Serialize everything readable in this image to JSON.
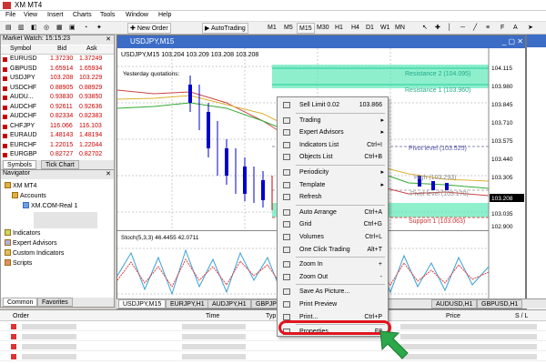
{
  "app": {
    "title": "XM MT4"
  },
  "menu": [
    "File",
    "View",
    "Insert",
    "Charts",
    "Tools",
    "Window",
    "Help"
  ],
  "toolbar": {
    "new_order": "New Order",
    "auto_trading": "AutoTrading",
    "timeframes": [
      "M1",
      "M5",
      "M15",
      "M30",
      "H1",
      "H4",
      "D1",
      "W1",
      "MN"
    ]
  },
  "market_watch": {
    "title": "Market Watch: 15:15:23",
    "cols": {
      "symbol": "Symbol",
      "bid": "Bid",
      "ask": "Ask"
    },
    "rows": [
      {
        "symbol": "EURUSD",
        "bid": "1.37230",
        "ask": "1.37249"
      },
      {
        "symbol": "GBPUSD",
        "bid": "1.65914",
        "ask": "1.65934"
      },
      {
        "symbol": "USDJPY",
        "bid": "103.208",
        "ask": "103.229"
      },
      {
        "symbol": "USDCHF",
        "bid": "0.88905",
        "ask": "0.88929"
      },
      {
        "symbol": "AUDU...",
        "bid": "0.93830",
        "ask": "0.93850"
      },
      {
        "symbol": "AUDCHF",
        "bid": "0.92611",
        "ask": "0.92636"
      },
      {
        "symbol": "AUDCHF",
        "bid": "0.82334",
        "ask": "0.82383"
      },
      {
        "symbol": "CHFJPY",
        "bid": "116.066",
        "ask": "116.103"
      },
      {
        "symbol": "EURAUD",
        "bid": "1.48143",
        "ask": "1.48194"
      },
      {
        "symbol": "EURCHF",
        "bid": "1.22015",
        "ask": "1.22044"
      },
      {
        "symbol": "EURGBP",
        "bid": "0.82727",
        "ask": "0.82702"
      }
    ],
    "tabs": [
      "Symbols",
      "Tick Chart"
    ]
  },
  "navigator": {
    "title": "Navigator",
    "items": [
      "XM MT4",
      "Accounts",
      "XM.COM-Real 1",
      "Indicators",
      "Expert Advisors",
      "Custom Indicators",
      "Scripts"
    ],
    "tabs": [
      "Common",
      "Favorites"
    ]
  },
  "chart": {
    "title": "USDJPY,M15",
    "header": "USDJPY,M15  103.204 103.209 103.208 103.208",
    "yesterday": "Yesterday quotations:",
    "prices": [
      "104.115",
      "103.980",
      "103.845",
      "103.710",
      "103.575",
      "103.440",
      "103.305",
      "103.208",
      "103.035",
      "102.900"
    ],
    "levels": {
      "r2": "Resistance 2 (104.095)",
      "r1": "Resistance 1 (103.960)",
      "pivot": "Pivot level (103.525)",
      "high": "High (103.293)",
      "pivot2": "Pivot level (103.170)",
      "s1": "Support 1 (103.063)"
    },
    "stoch": "Stoch(5,3,3) 46.4455 42.0711"
  },
  "chart_tabs": [
    "USDJPY,M15",
    "EURJPY,H1",
    "AUDJPY,H1",
    "GBPJPY",
    "...",
    "AUDUSD,H1",
    "GBPUSD,H1"
  ],
  "context_menu": [
    {
      "label": "Sell Limit 0.02",
      "sc": "103.866"
    },
    {
      "label": "Trading",
      "arrow": true
    },
    {
      "label": "Expert Advisors",
      "arrow": true
    },
    {
      "label": "Indicators List",
      "sc": "Ctrl+I"
    },
    {
      "label": "Objects List",
      "sc": "Ctrl+B"
    },
    {
      "label": "Periodicity",
      "arrow": true
    },
    {
      "label": "Template",
      "arrow": true
    },
    {
      "label": "Refresh",
      "sc": ""
    },
    {
      "label": "Auto Arrange",
      "sc": "Ctrl+A"
    },
    {
      "label": "Grid",
      "sc": "Ctrl+G"
    },
    {
      "label": "Volumes",
      "sc": "Ctrl+L"
    },
    {
      "label": "One Click Trading",
      "sc": "Alt+T"
    },
    {
      "label": "Zoom In",
      "sc": "+"
    },
    {
      "label": "Zoom Out",
      "sc": "-"
    },
    {
      "label": "Save As Picture...",
      "sc": ""
    },
    {
      "label": "Print Preview",
      "sc": ""
    },
    {
      "label": "Print...",
      "sc": "Ctrl+P"
    },
    {
      "label": "Properties...",
      "sc": "F8"
    }
  ],
  "terminal": {
    "cols": {
      "order": "Order",
      "time": "Time",
      "type": "Typ",
      "price": "Price",
      "sl": "S / L"
    }
  },
  "colors": {
    "highlight": "#e0141e",
    "arrow": "#2aa84a",
    "caption": "#3b6dc6"
  }
}
